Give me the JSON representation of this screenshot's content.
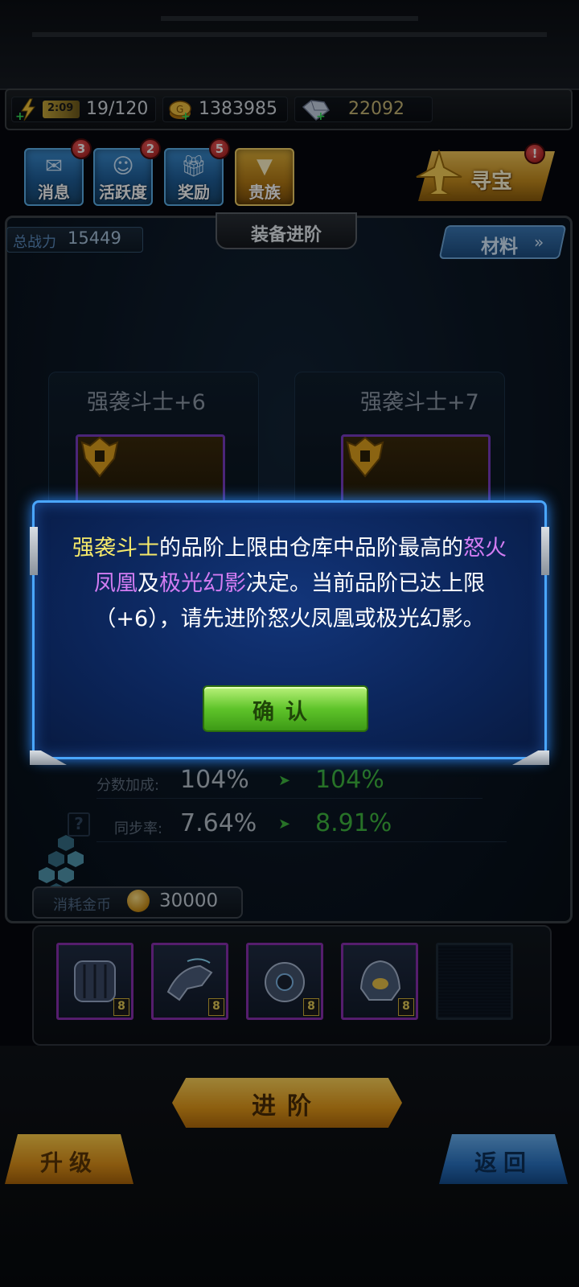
{
  "resources": {
    "energy_timer": "2:09",
    "energy": "19/120",
    "gold": "1383985",
    "gems": "22092"
  },
  "shortcuts": [
    {
      "label": "消息",
      "badge": "3",
      "icon": "envelope-icon"
    },
    {
      "label": "活跃度",
      "badge": "2",
      "icon": "smiley-medal-icon"
    },
    {
      "label": "奖励",
      "badge": "5",
      "icon": "gift-icon"
    },
    {
      "label": "贵族",
      "badge": "",
      "icon": "noble-chevron-icon"
    }
  ],
  "treasure": {
    "label": "寻宝",
    "badge": "!",
    "icon": "fighter-jet-icon"
  },
  "panel": {
    "power_label": "总战力",
    "power_value": "15449",
    "title": "装备进阶",
    "materials_label": "材料",
    "materials_icon": "double-chevron-icon"
  },
  "equipment": {
    "current_name": "强袭斗士+6",
    "next_name": "强袭斗士+7"
  },
  "stats": [
    {
      "label": "分数加成:",
      "from": "104%",
      "to": "104%"
    },
    {
      "label": "同步率:",
      "from": "7.64%",
      "to": "8.91%"
    }
  ],
  "cost": {
    "label": "消耗金币",
    "value": "30000"
  },
  "materials": [
    {
      "level": "8",
      "icon": "armor-barrel-icon"
    },
    {
      "level": "8",
      "icon": "wing-boot-icon"
    },
    {
      "level": "8",
      "icon": "orb-pod-icon"
    },
    {
      "level": "8",
      "icon": "helmet-icon"
    },
    {
      "level": "",
      "icon": "empty-slot"
    }
  ],
  "buttons": {
    "advance": "进阶",
    "upgrade": "升级",
    "back": "返回"
  },
  "dialog": {
    "item": "强袭斗士",
    "text1": "的品阶上限由仓库中品阶最高的",
    "mat1": "怒火凤凰",
    "text2": "及",
    "mat2": "极光幻影",
    "text3": "决定。当前品阶已达上限（+6），请先进阶怒火凤凰或极光幻影。",
    "confirm": "确认"
  },
  "colors": {
    "dialog_border": "#4aa6ff",
    "highlight_item": "#f5e96a",
    "highlight_material": "#d27cf2",
    "stat_increase": "#3fb83f"
  }
}
